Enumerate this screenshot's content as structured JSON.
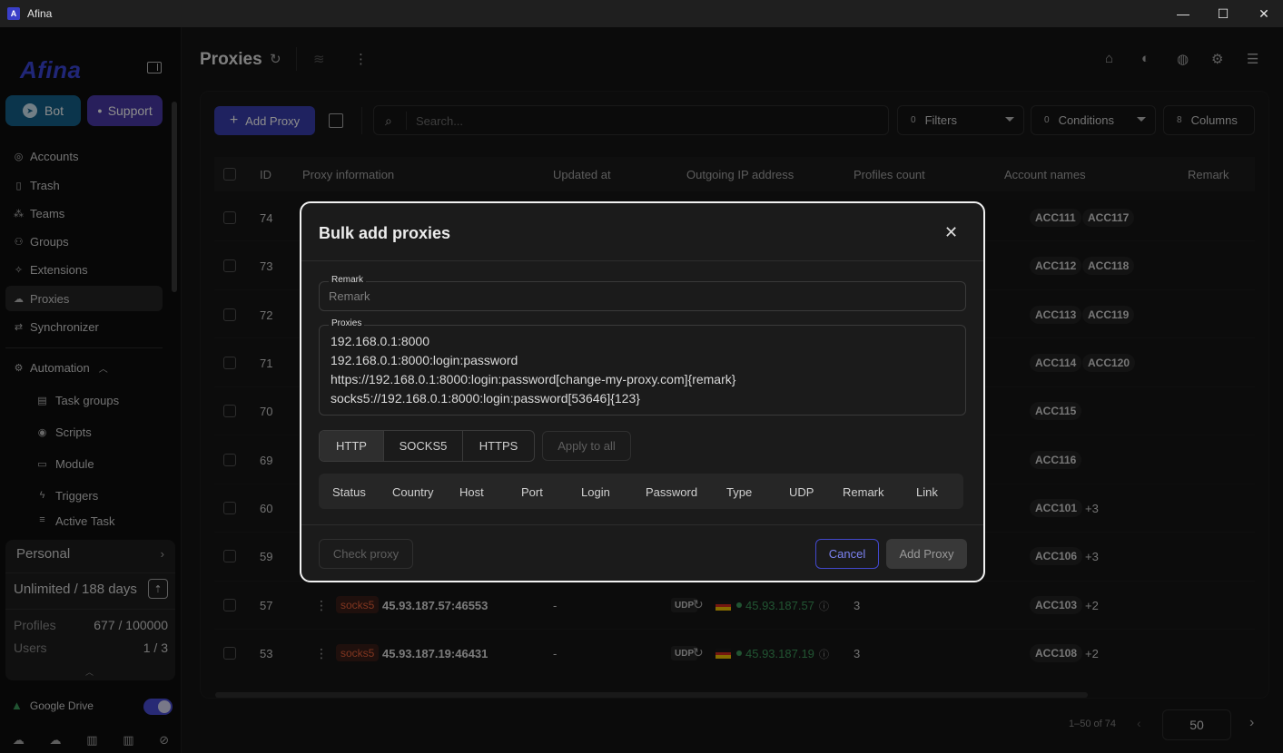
{
  "window": {
    "title": "Afina"
  },
  "sidebar": {
    "logo": "Afina",
    "bot_label": "Bot",
    "support_label": "Support",
    "nav": [
      "Accounts",
      "Trash",
      "Teams",
      "Groups",
      "Extensions",
      "Proxies",
      "Synchronizer"
    ],
    "automation_label": "Automation",
    "automation_items": [
      "Task groups",
      "Scripts",
      "Module",
      "Triggers",
      "Active Task"
    ],
    "plan": {
      "name": "Personal",
      "duration": "Unlimited / 188 days",
      "profiles_label": "Profiles",
      "profiles_value": "677 / 100000",
      "users_label": "Users",
      "users_value": "1 / 3"
    },
    "gdrive_label": "Google Drive"
  },
  "main": {
    "title": "Proxies",
    "add_proxy_label": "Add Proxy",
    "search_placeholder": "Search...",
    "filters": {
      "count": "0",
      "label": "Filters"
    },
    "conditions": {
      "count": "0",
      "label": "Conditions"
    },
    "columns": {
      "count": "8",
      "label": "Columns"
    },
    "table": {
      "headers": [
        "ID",
        "Proxy information",
        "Updated at",
        "Outgoing IP address",
        "Profiles count",
        "Account names",
        "Remark"
      ],
      "rows": [
        {
          "id": "74",
          "accounts": [
            "ACC111",
            "ACC117"
          ],
          "more": ""
        },
        {
          "id": "73",
          "accounts": [
            "ACC112",
            "ACC118"
          ],
          "more": ""
        },
        {
          "id": "72",
          "accounts": [
            "ACC113",
            "ACC119"
          ],
          "more": ""
        },
        {
          "id": "71",
          "accounts": [
            "ACC114",
            "ACC120"
          ],
          "more": ""
        },
        {
          "id": "70",
          "accounts": [
            "ACC115"
          ],
          "more": ""
        },
        {
          "id": "69",
          "accounts": [
            "ACC116"
          ],
          "more": ""
        },
        {
          "id": "60",
          "accounts": [
            "ACC101"
          ],
          "more": "+3"
        },
        {
          "id": "59",
          "accounts": [
            "ACC106"
          ],
          "more": "+3"
        },
        {
          "id": "57",
          "protocol": "socks5",
          "host": "45.93.187.57:46553",
          "udp": "UDP",
          "updated": "-",
          "ip": "45.93.187.57",
          "profiles": "3",
          "accounts": [
            "ACC103"
          ],
          "more": "+2"
        },
        {
          "id": "53",
          "protocol": "socks5",
          "host": "45.93.187.19:46431",
          "udp": "UDP",
          "updated": "-",
          "ip": "45.93.187.19",
          "profiles": "3",
          "accounts": [
            "ACC108"
          ],
          "more": "+2"
        }
      ]
    },
    "pagination": {
      "range": "1–50 of 74",
      "page_size": "50"
    }
  },
  "modal": {
    "title": "Bulk add proxies",
    "remark_label": "Remark",
    "remark_placeholder": "Remark",
    "proxies_label": "Proxies",
    "proxies_lines": [
      "192.168.0.1:8000",
      "192.168.0.1:8000:login:password",
      "https://192.168.0.1:8000:login:password[change-my-proxy.com]{remark}",
      "socks5://192.168.0.1:8000:login:password[53646]{123}"
    ],
    "types": [
      "HTTP",
      "SOCKS5",
      "HTTPS"
    ],
    "selected_type": "HTTP",
    "apply_label": "Apply to all",
    "columns": [
      "Status",
      "Country",
      "Host",
      "Port",
      "Login",
      "Password",
      "Type",
      "UDP",
      "Remark",
      "Link"
    ],
    "check_label": "Check proxy",
    "cancel_label": "Cancel",
    "add_label": "Add Proxy"
  }
}
